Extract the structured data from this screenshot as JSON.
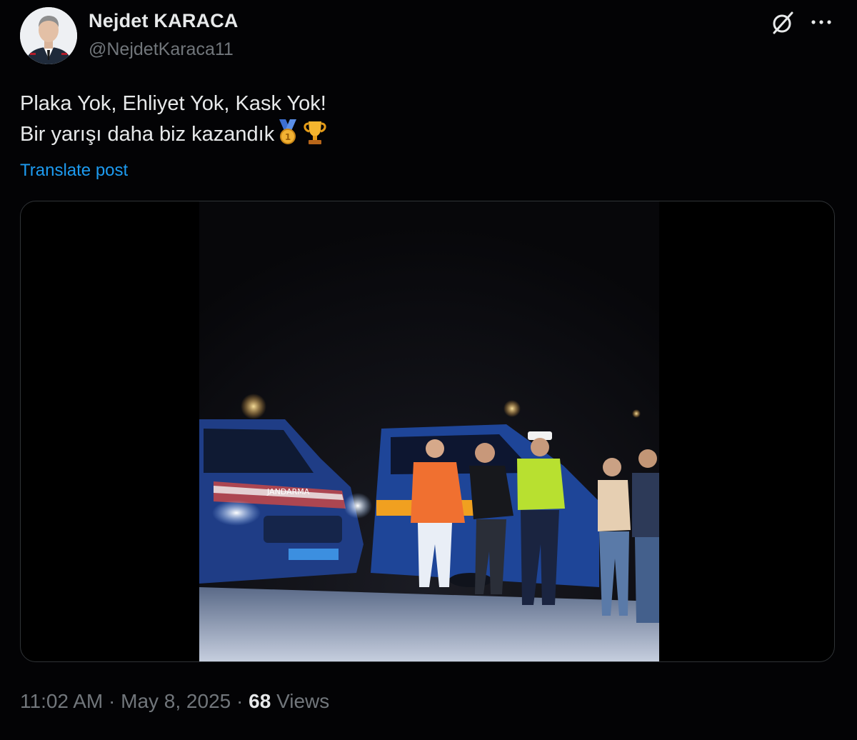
{
  "author": {
    "name": "Nejdet KARACA",
    "handle": "@NejdetKaraca11"
  },
  "post": {
    "lines": [
      "Plaka Yok, Ehliyet Yok, Kask Yok!",
      "Bir yarışı daha biz kazandık"
    ],
    "emojis": [
      "medal-icon",
      "trophy-icon"
    ],
    "translate_label": "Translate post"
  },
  "header_icons": [
    "grok-icon",
    "more-icon"
  ],
  "meta": {
    "time": "11:02 AM",
    "separator": "·",
    "date": "May 8, 2025",
    "views_count": "68",
    "views_label": "Views"
  },
  "media": {
    "van_marking": "JANDARMA"
  },
  "colors": {
    "background": "#030305",
    "text": "#e7e9ea",
    "muted": "#71767b",
    "link": "#1d9bf0",
    "border": "#2f3336"
  }
}
